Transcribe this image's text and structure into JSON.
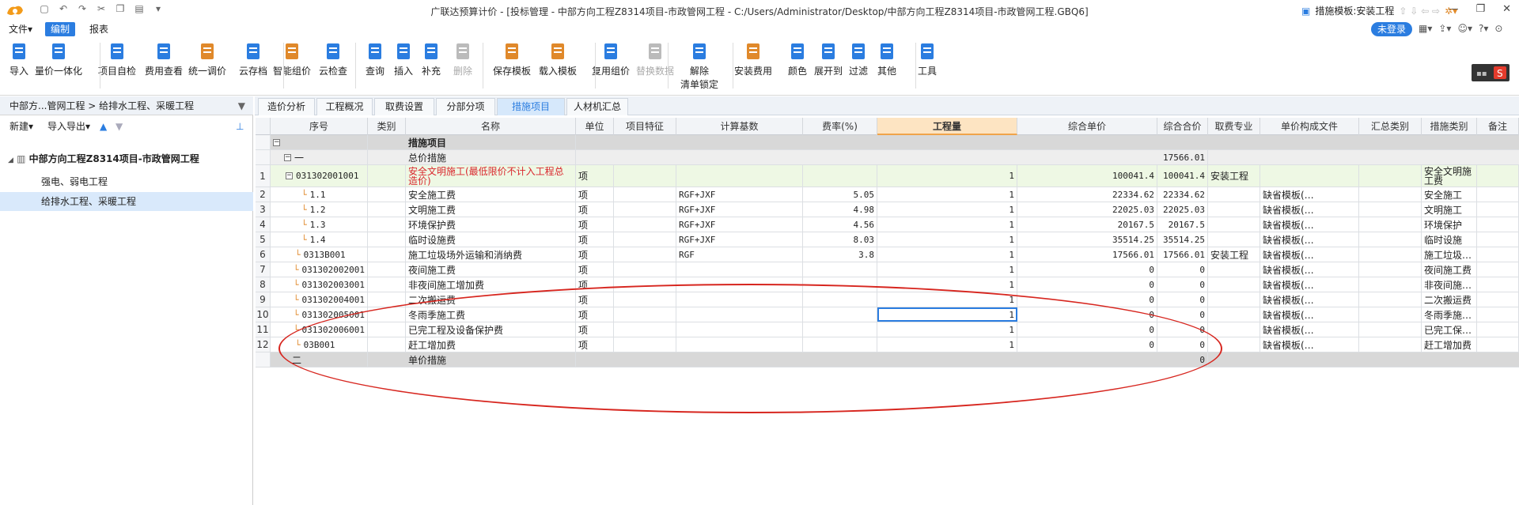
{
  "window": {
    "title": "广联达预算计价 - [投标管理 - 中部方向工程Z8314项目-市政管网工程 - C:/Users/Administrator/Desktop/中部方向工程Z8314项目-市政管网工程.GBQ6]",
    "login": "未登录"
  },
  "menu": [
    "文件▾",
    "编制",
    "报表"
  ],
  "ribbon": [
    {
      "label": "导入",
      "icon": "import-icon"
    },
    {
      "label": "量价一体化",
      "icon": "integration-icon"
    },
    {
      "label": "项目自检",
      "icon": "self-check-icon"
    },
    {
      "label": "费用查看",
      "icon": "fee-view-icon"
    },
    {
      "label": "统一调价",
      "icon": "price-adjust-icon"
    },
    {
      "label": "云存档",
      "icon": "cloud-archive-icon"
    },
    {
      "label": "智能组价",
      "icon": "smart-pricing-icon"
    },
    {
      "label": "云检查",
      "icon": "cloud-check-icon"
    },
    {
      "label": "查询",
      "icon": "query-icon"
    },
    {
      "label": "插入",
      "icon": "insert-icon"
    },
    {
      "label": "补充",
      "icon": "supplement-icon"
    },
    {
      "label": "删除",
      "icon": "delete-icon"
    },
    {
      "label": "保存模板",
      "icon": "save-template-icon"
    },
    {
      "label": "载入模板",
      "icon": "load-template-icon"
    },
    {
      "label": "复用组价",
      "icon": "reuse-pricing-icon"
    },
    {
      "label": "替换数据",
      "icon": "replace-data-icon"
    },
    {
      "label": "解除",
      "label2": "清单锁定",
      "icon": "unlock-icon"
    },
    {
      "label": "安装费用",
      "icon": "install-fee-icon"
    },
    {
      "label": "颜色",
      "icon": "color-icon"
    },
    {
      "label": "展开到",
      "icon": "expand-icon"
    },
    {
      "label": "过滤",
      "icon": "filter-icon"
    },
    {
      "label": "其他",
      "icon": "other-icon"
    },
    {
      "label": "工具",
      "icon": "tools-icon"
    }
  ],
  "left": {
    "breadcrumb": "中部方...管网工程 > 给排水工程、采暖工程",
    "new": "新建▾",
    "importexport": "导入导出▾",
    "root": "中部方向工程Z8314项目-市政管网工程",
    "items": [
      "强电、弱电工程",
      "给排水工程、采暖工程"
    ]
  },
  "tabs": [
    "造价分析",
    "工程概况",
    "取费设置",
    "分部分项",
    "措施项目",
    "人材机汇总"
  ],
  "active_tab": "措施项目",
  "template_label": "措施模板:安装工程",
  "columns": [
    "序号",
    "类别",
    "名称",
    "单位",
    "项目特征",
    "计算基数",
    "费率(%)",
    "工程量",
    "综合单价",
    "综合合价",
    "取费专业",
    "单价构成文件",
    "汇总类别",
    "措施类别",
    "备注"
  ],
  "section_title": "措施项目",
  "group1": {
    "num": "一",
    "name": "总价措施",
    "total": "17566.01"
  },
  "rows": [
    {
      "rn": "1",
      "code": "031302001001",
      "name": "安全文明施工(最低限价不计入工程总造价)",
      "unit": "项",
      "base": "",
      "rate": "",
      "qty": "1",
      "price": "100041.4",
      "total": "100041.4",
      "major": "安装工程",
      "file": "",
      "cat": "安全文明施工费"
    },
    {
      "rn": "2",
      "code": "1.1",
      "name": "安全施工费",
      "unit": "项",
      "base": "RGF+JXF",
      "rate": "5.05",
      "qty": "1",
      "price": "22334.62",
      "total": "22334.62",
      "major": "",
      "file": "缺省模板(…",
      "cat": "安全施工"
    },
    {
      "rn": "3",
      "code": "1.2",
      "name": "文明施工费",
      "unit": "项",
      "base": "RGF+JXF",
      "rate": "4.98",
      "qty": "1",
      "price": "22025.03",
      "total": "22025.03",
      "major": "",
      "file": "缺省模板(…",
      "cat": "文明施工"
    },
    {
      "rn": "4",
      "code": "1.3",
      "name": "环境保护费",
      "unit": "项",
      "base": "RGF+JXF",
      "rate": "4.56",
      "qty": "1",
      "price": "20167.5",
      "total": "20167.5",
      "major": "",
      "file": "缺省模板(…",
      "cat": "环境保护"
    },
    {
      "rn": "5",
      "code": "1.4",
      "name": "临时设施费",
      "unit": "项",
      "base": "RGF+JXF",
      "rate": "8.03",
      "qty": "1",
      "price": "35514.25",
      "total": "35514.25",
      "major": "",
      "file": "缺省模板(…",
      "cat": "临时设施"
    },
    {
      "rn": "6",
      "code": "0313B001",
      "name": "施工垃圾场外运输和消纳费",
      "unit": "项",
      "base": "RGF",
      "rate": "3.8",
      "qty": "1",
      "price": "17566.01",
      "total": "17566.01",
      "major": "安装工程",
      "file": "缺省模板(…",
      "cat": "施工垃圾…"
    },
    {
      "rn": "7",
      "code": "031302002001",
      "name": "夜间施工费",
      "unit": "项",
      "base": "",
      "rate": "",
      "qty": "1",
      "price": "0",
      "total": "0",
      "major": "",
      "file": "缺省模板(…",
      "cat": "夜间施工费"
    },
    {
      "rn": "8",
      "code": "031302003001",
      "name": "非夜间施工增加费",
      "unit": "项",
      "base": "",
      "rate": "",
      "qty": "1",
      "price": "0",
      "total": "0",
      "major": "",
      "file": "缺省模板(…",
      "cat": "非夜间施…"
    },
    {
      "rn": "9",
      "code": "031302004001",
      "name": "二次搬运费",
      "unit": "项",
      "base": "",
      "rate": "",
      "qty": "1",
      "price": "0",
      "total": "0",
      "major": "",
      "file": "缺省模板(…",
      "cat": "二次搬运费"
    },
    {
      "rn": "10",
      "code": "031302005001",
      "name": "冬雨季施工费",
      "unit": "项",
      "base": "",
      "rate": "",
      "qty": "1",
      "price": "0",
      "total": "0",
      "major": "",
      "file": "缺省模板(…",
      "cat": "冬雨季施…"
    },
    {
      "rn": "11",
      "code": "031302006001",
      "name": "已完工程及设备保护费",
      "unit": "项",
      "base": "",
      "rate": "",
      "qty": "1",
      "price": "0",
      "total": "0",
      "major": "",
      "file": "缺省模板(…",
      "cat": "已完工保…"
    },
    {
      "rn": "12",
      "code": "03B001",
      "name": "赶工增加费",
      "unit": "项",
      "base": "",
      "rate": "",
      "qty": "1",
      "price": "0",
      "total": "0",
      "major": "",
      "file": "缺省模板(…",
      "cat": "赶工增加费"
    }
  ],
  "group2": {
    "num": "二",
    "name": "单价措施",
    "total": "0"
  },
  "colors": {
    "accent": "#2b7de0",
    "annotation": "#d7261f",
    "highlight_header": "#fde4c2"
  }
}
